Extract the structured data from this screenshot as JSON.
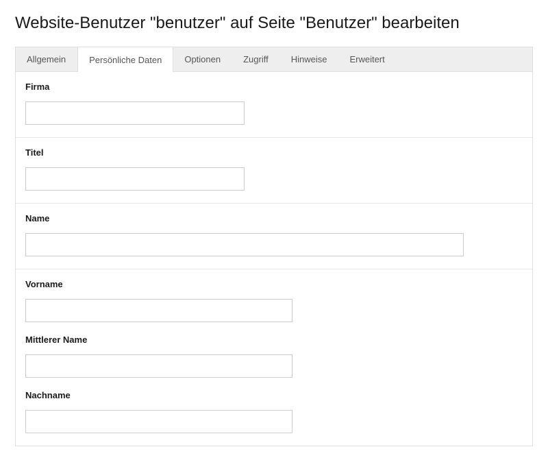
{
  "title": "Website-Benutzer \"benutzer\" auf Seite \"Benutzer\" bearbeiten",
  "tabs": {
    "allgemein": "Allgemein",
    "persoenliche_daten": "Persönliche Daten",
    "optionen": "Optionen",
    "zugriff": "Zugriff",
    "hinweise": "Hinweise",
    "erweitert": "Erweitert",
    "active": "persoenliche_daten"
  },
  "fields": {
    "firma": {
      "label": "Firma",
      "value": ""
    },
    "titel": {
      "label": "Titel",
      "value": ""
    },
    "name": {
      "label": "Name",
      "value": ""
    },
    "vorname": {
      "label": "Vorname",
      "value": ""
    },
    "mittlerer_name": {
      "label": "Mittlerer Name",
      "value": ""
    },
    "nachname": {
      "label": "Nachname",
      "value": ""
    }
  }
}
